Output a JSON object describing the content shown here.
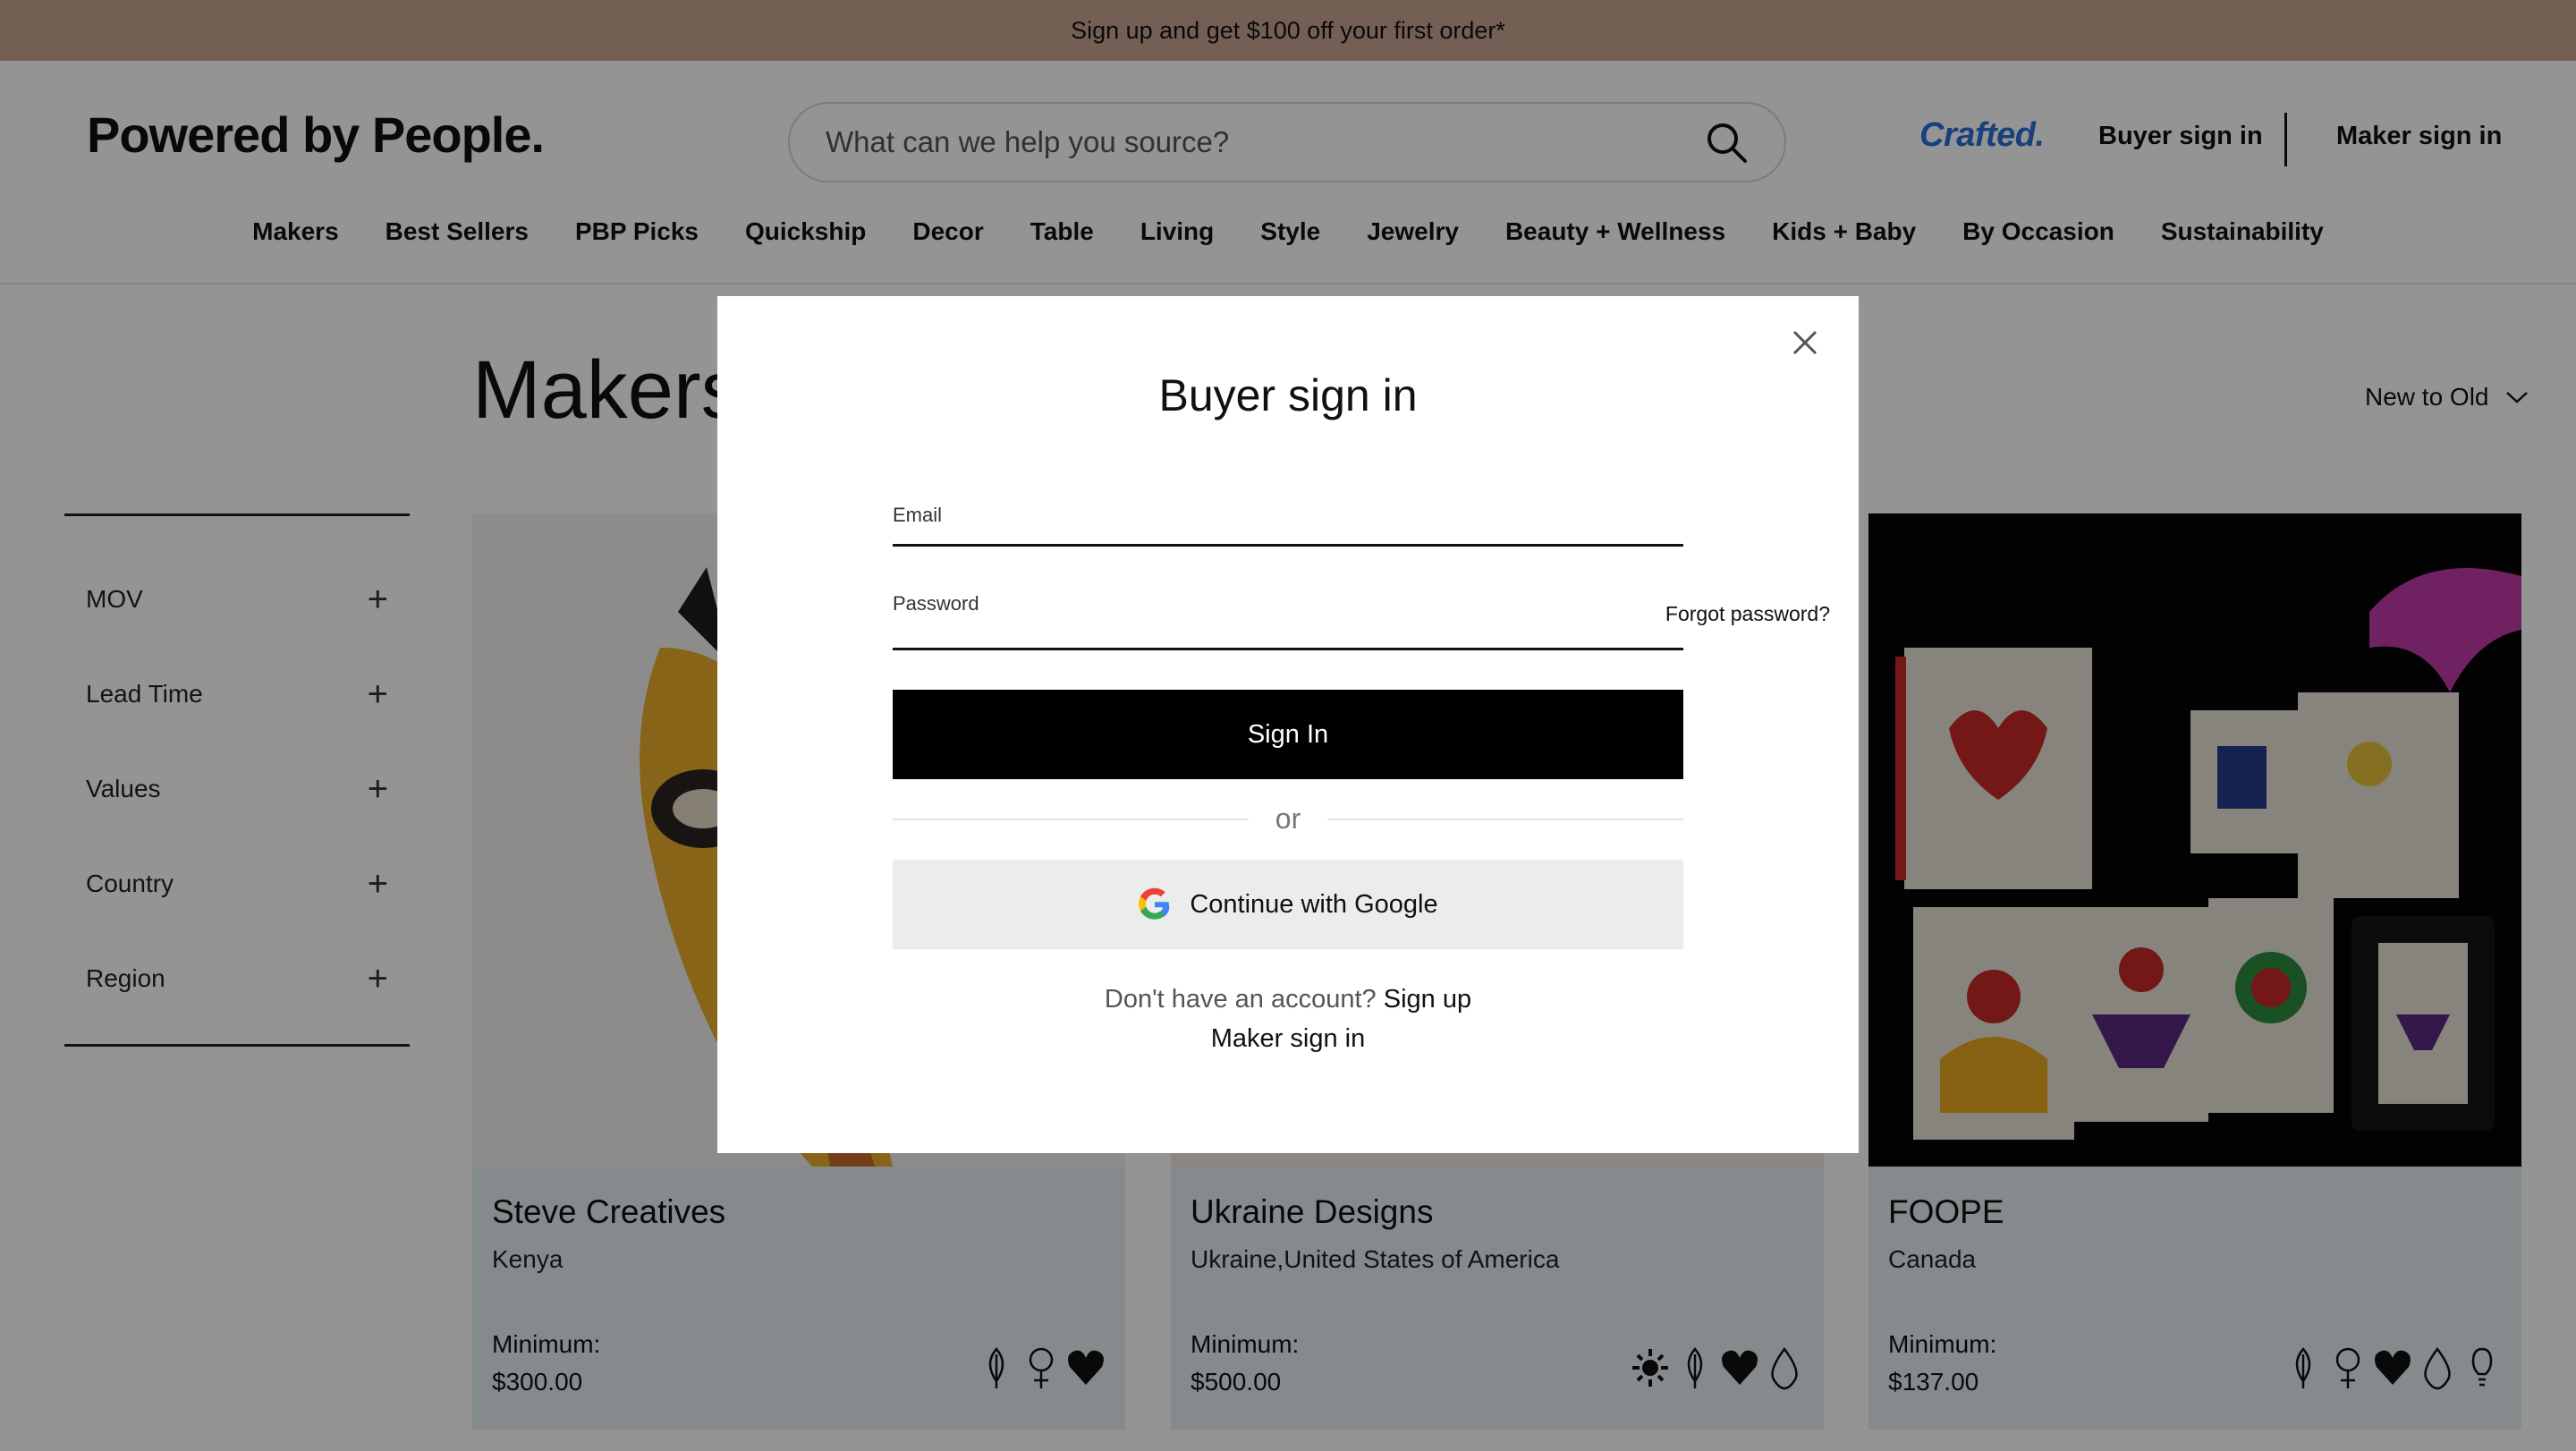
{
  "announcement": "Sign up and get $100 off your first order*",
  "header": {
    "logo": "Powered by People.",
    "search_placeholder": "What can we help you source?",
    "crafted": "Crafted.",
    "buyer_sign_in": "Buyer sign in",
    "maker_sign_in": "Maker sign in"
  },
  "nav": [
    "Makers",
    "Best Sellers",
    "PBP Picks",
    "Quickship",
    "Decor",
    "Table",
    "Living",
    "Style",
    "Jewelry",
    "Beauty + Wellness",
    "Kids + Baby",
    "By Occasion",
    "Sustainability"
  ],
  "page": {
    "title": "Makers",
    "sort_label": "New to Old"
  },
  "filters": [
    "MOV",
    "Lead Time",
    "Values",
    "Country",
    "Region"
  ],
  "cards": [
    {
      "name": "Steve Creatives",
      "country": "Kenya",
      "min_label": "Minimum:",
      "min_value": "$300.00",
      "icons": [
        "leaf-icon",
        "female-icon",
        "heart-icon"
      ]
    },
    {
      "name": "Ukraine Designs",
      "country": "Ukraine,United States of America",
      "min_label": "Minimum:",
      "min_value": "$500.00",
      "icons": [
        "sun-icon",
        "leaf-icon",
        "heart-icon",
        "drop-icon"
      ]
    },
    {
      "name": "FOOPE",
      "country": "Canada",
      "min_label": "Minimum:",
      "min_value": "$137.00",
      "icons": [
        "leaf-icon",
        "female-icon",
        "heart-icon",
        "drop-icon",
        "bulb-icon"
      ]
    }
  ],
  "modal": {
    "title": "Buyer sign in",
    "email_label": "Email",
    "password_label": "Password",
    "forgot": "Forgot password?",
    "sign_in": "Sign In",
    "or": "or",
    "google": "Continue with Google",
    "no_account": "Don't have an account?",
    "sign_up": "Sign up",
    "maker_sign_in": "Maker sign in"
  }
}
